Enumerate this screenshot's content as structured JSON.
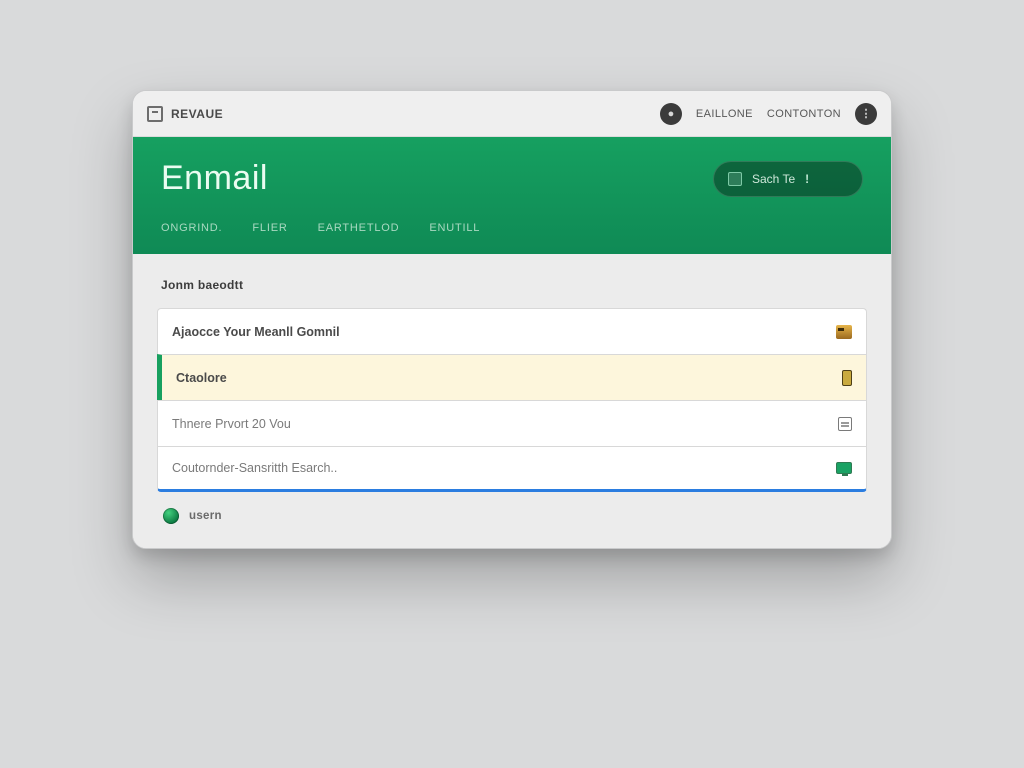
{
  "titlebar": {
    "app_label": "Revaue",
    "nav": {
      "item1": "Eaillone",
      "item2": "Contonton"
    },
    "menu_glyph": "⋮"
  },
  "header": {
    "title": "Enmail",
    "search": {
      "label": "Sach Te",
      "bang": "!"
    },
    "tabs": [
      "Ongrind.",
      "Flier",
      "Earthetlod",
      "Enutill"
    ]
  },
  "section": {
    "label": "Jonm baeodtt"
  },
  "rows": [
    {
      "subject": "Ajaocce Your Meanll Gomnil"
    },
    {
      "subject": "Ctaolore"
    },
    {
      "subject": "Thnere Prvort 20 Vou"
    },
    {
      "subject": "Coutornder-Sansritth Esarch.."
    }
  ],
  "footer": {
    "label": "usern"
  }
}
